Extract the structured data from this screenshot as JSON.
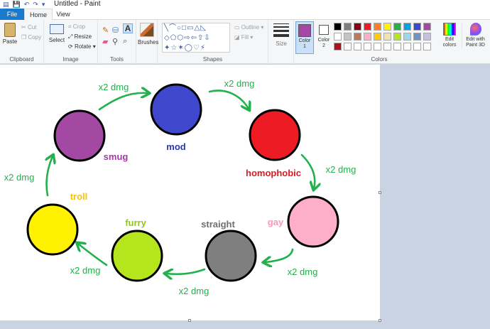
{
  "titlebar": {
    "title": "Untitled - Paint"
  },
  "tabs": {
    "file": "File",
    "home": "Home",
    "view": "View"
  },
  "clipboard": {
    "paste": "Paste",
    "cut": "Cut",
    "copy": "Copy",
    "label": "Clipboard"
  },
  "image": {
    "select": "Select",
    "crop": "Crop",
    "resize": "Resize",
    "rotate": "Rotate",
    "label": "Image"
  },
  "tools": {
    "label": "Tools",
    "text_tool": "A"
  },
  "brushes": {
    "label": "Brushes"
  },
  "shapes": {
    "label": "Shapes",
    "outline": "Outline",
    "fill": "Fill"
  },
  "size": {
    "label": "Size"
  },
  "colors": {
    "color1": "Color 1",
    "color2": "Color 2",
    "label": "Colors",
    "edit": "Edit colors",
    "paint3d": "Edit with Paint 3D",
    "color1_value": "#a349a4",
    "color2_value": "#ffffff",
    "palette_row1": [
      "#000000",
      "#7f7f7f",
      "#880015",
      "#ed1c24",
      "#ff7f27",
      "#fff200",
      "#22b14c",
      "#00a2e8",
      "#3f48cc",
      "#a349a4"
    ],
    "palette_row2": [
      "#ffffff",
      "#c3c3c3",
      "#b97a57",
      "#ffaec9",
      "#ffc90e",
      "#efe4b0",
      "#b5e61d",
      "#99d9ea",
      "#7092be",
      "#c8bfe7"
    ],
    "palette_row3": [
      "#b0101a"
    ]
  },
  "diagram": {
    "nodes": [
      {
        "id": "mod",
        "label": "mod",
        "color": "#3f48cc",
        "label_color": "#2b35b0"
      },
      {
        "id": "homophobic",
        "label": "homophobic",
        "color": "#ed1c24",
        "label_color": "#e01820"
      },
      {
        "id": "gay",
        "label": "gay",
        "color": "#ffaec9",
        "label_color": "#f39ab9"
      },
      {
        "id": "straight",
        "label": "straight",
        "color": "#7f7f7f",
        "label_color": "#6e6e6e"
      },
      {
        "id": "furry",
        "label": "furry",
        "color": "#b5e61d",
        "label_color": "#94c61a"
      },
      {
        "id": "troll",
        "label": "troll",
        "color": "#fff200",
        "label_color": "#f3c311"
      },
      {
        "id": "smug",
        "label": "smug",
        "color": "#a349a4",
        "label_color": "#9a3f9b"
      }
    ],
    "edge_label": "x2 dmg",
    "edge_color": "#22b14c"
  }
}
